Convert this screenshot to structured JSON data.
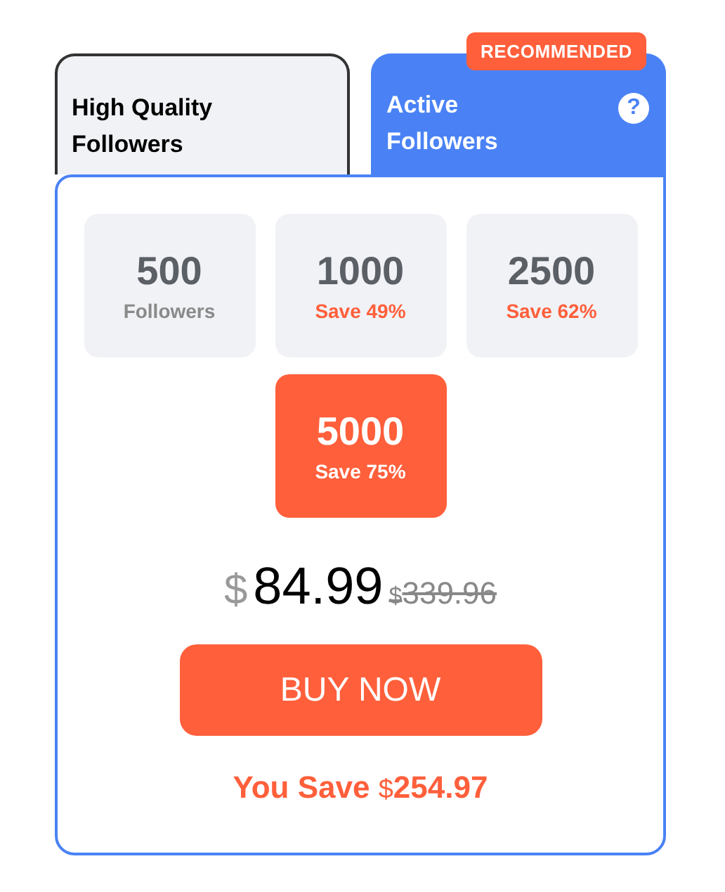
{
  "tabs": [
    {
      "label": "High Quality Followers",
      "selected": false
    },
    {
      "label": "Active Followers",
      "selected": true,
      "badge": "RECOMMENDED",
      "help": "?"
    }
  ],
  "options": [
    {
      "amount": "500",
      "caption": "Followers",
      "kind": "label",
      "selected": false
    },
    {
      "amount": "1000",
      "caption": "Save 49%",
      "kind": "discount",
      "selected": false
    },
    {
      "amount": "2500",
      "caption": "Save 62%",
      "kind": "discount",
      "selected": false
    },
    {
      "amount": "5000",
      "caption": "Save 75%",
      "kind": "discount",
      "selected": true
    }
  ],
  "price": {
    "currency": "$",
    "amount": "84.99",
    "old_currency": "$",
    "old_amount": "339.96"
  },
  "buy_button": "BUY NOW",
  "savings": {
    "label": "You Save",
    "currency": "$",
    "amount": "254.97"
  }
}
